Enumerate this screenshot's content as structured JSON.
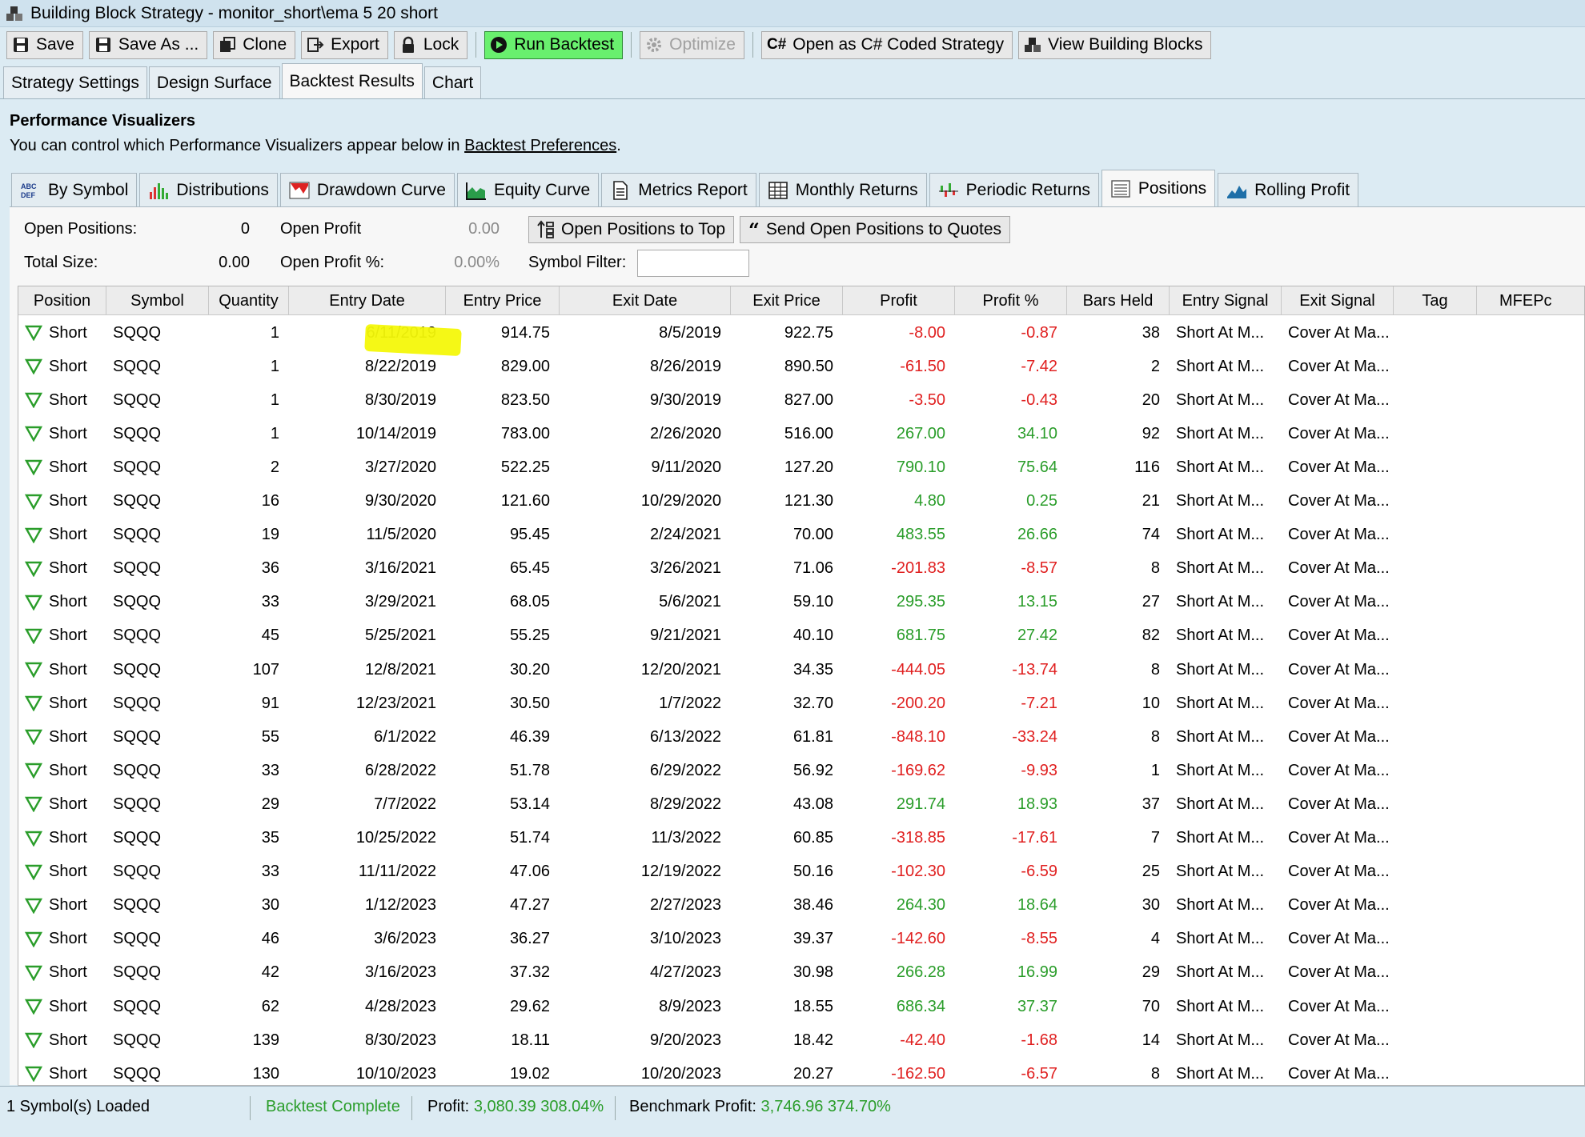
{
  "window": {
    "title": "Building Block Strategy - monitor_short\\ema 5 20 short"
  },
  "toolbar": {
    "save": "Save",
    "save_as": "Save As ...",
    "clone": "Clone",
    "export": "Export",
    "lock": "Lock",
    "run_backtest": "Run Backtest",
    "optimize": "Optimize",
    "open_csharp": "Open as C# Coded Strategy",
    "view_blocks": "View Building Blocks"
  },
  "main_tabs": [
    "Strategy Settings",
    "Design Surface",
    "Backtest Results",
    "Chart"
  ],
  "performance": {
    "title": "Performance Visualizers",
    "subtitle": "You can control which Performance Visualizers appear below in",
    "link": "Backtest Preferences",
    "period": "."
  },
  "vis_tabs": [
    "By Symbol",
    "Distributions",
    "Drawdown Curve",
    "Equity Curve",
    "Metrics Report",
    "Monthly Returns",
    "Periodic Returns",
    "Positions",
    "Rolling Profit"
  ],
  "positions_panel": {
    "open_positions_label": "Open Positions:",
    "open_positions_value": "0",
    "open_profit_label": "Open Profit",
    "open_profit_value": "0.00",
    "total_size_label": "Total Size:",
    "total_size_value": "0.00",
    "open_profit_pct_label": "Open Profit %:",
    "open_profit_pct_value": "0.00%",
    "btn_open_top": "Open Positions to Top",
    "btn_send_quotes": "Send Open Positions to Quotes",
    "symbol_filter_label": "Symbol Filter:",
    "symbol_filter_value": ""
  },
  "table": {
    "columns": [
      "Position",
      "Symbol",
      "Quantity",
      "Entry Date",
      "Entry Price",
      "Exit Date",
      "Exit Price",
      "Profit",
      "Profit %",
      "Bars Held",
      "Entry Signal",
      "Exit Signal",
      "Tag",
      "MFEPc"
    ],
    "rows": [
      [
        "Short",
        "SQQQ",
        "1",
        "6/11/2019",
        "914.75",
        "8/5/2019",
        "922.75",
        "-8.00",
        "-0.87",
        "38",
        "Short At M...",
        "Cover At Ma...",
        ""
      ],
      [
        "Short",
        "SQQQ",
        "1",
        "8/22/2019",
        "829.00",
        "8/26/2019",
        "890.50",
        "-61.50",
        "-7.42",
        "2",
        "Short At M...",
        "Cover At Ma...",
        ""
      ],
      [
        "Short",
        "SQQQ",
        "1",
        "8/30/2019",
        "823.50",
        "9/30/2019",
        "827.00",
        "-3.50",
        "-0.43",
        "20",
        "Short At M...",
        "Cover At Ma...",
        ""
      ],
      [
        "Short",
        "SQQQ",
        "1",
        "10/14/2019",
        "783.00",
        "2/26/2020",
        "516.00",
        "267.00",
        "34.10",
        "92",
        "Short At M...",
        "Cover At Ma...",
        ""
      ],
      [
        "Short",
        "SQQQ",
        "2",
        "3/27/2020",
        "522.25",
        "9/11/2020",
        "127.20",
        "790.10",
        "75.64",
        "116",
        "Short At M...",
        "Cover At Ma...",
        ""
      ],
      [
        "Short",
        "SQQQ",
        "16",
        "9/30/2020",
        "121.60",
        "10/29/2020",
        "121.30",
        "4.80",
        "0.25",
        "21",
        "Short At M...",
        "Cover At Ma...",
        ""
      ],
      [
        "Short",
        "SQQQ",
        "19",
        "11/5/2020",
        "95.45",
        "2/24/2021",
        "70.00",
        "483.55",
        "26.66",
        "74",
        "Short At M...",
        "Cover At Ma...",
        ""
      ],
      [
        "Short",
        "SQQQ",
        "36",
        "3/16/2021",
        "65.45",
        "3/26/2021",
        "71.06",
        "-201.83",
        "-8.57",
        "8",
        "Short At M...",
        "Cover At Ma...",
        ""
      ],
      [
        "Short",
        "SQQQ",
        "33",
        "3/29/2021",
        "68.05",
        "5/6/2021",
        "59.10",
        "295.35",
        "13.15",
        "27",
        "Short At M...",
        "Cover At Ma...",
        ""
      ],
      [
        "Short",
        "SQQQ",
        "45",
        "5/25/2021",
        "55.25",
        "9/21/2021",
        "40.10",
        "681.75",
        "27.42",
        "82",
        "Short At M...",
        "Cover At Ma...",
        ""
      ],
      [
        "Short",
        "SQQQ",
        "107",
        "12/8/2021",
        "30.20",
        "12/20/2021",
        "34.35",
        "-444.05",
        "-13.74",
        "8",
        "Short At M...",
        "Cover At Ma...",
        ""
      ],
      [
        "Short",
        "SQQQ",
        "91",
        "12/23/2021",
        "30.50",
        "1/7/2022",
        "32.70",
        "-200.20",
        "-7.21",
        "10",
        "Short At M...",
        "Cover At Ma...",
        ""
      ],
      [
        "Short",
        "SQQQ",
        "55",
        "6/1/2022",
        "46.39",
        "6/13/2022",
        "61.81",
        "-848.10",
        "-33.24",
        "8",
        "Short At M...",
        "Cover At Ma...",
        ""
      ],
      [
        "Short",
        "SQQQ",
        "33",
        "6/28/2022",
        "51.78",
        "6/29/2022",
        "56.92",
        "-169.62",
        "-9.93",
        "1",
        "Short At M...",
        "Cover At Ma...",
        ""
      ],
      [
        "Short",
        "SQQQ",
        "29",
        "7/7/2022",
        "53.14",
        "8/29/2022",
        "43.08",
        "291.74",
        "18.93",
        "37",
        "Short At M...",
        "Cover At Ma...",
        ""
      ],
      [
        "Short",
        "SQQQ",
        "35",
        "10/25/2022",
        "51.74",
        "11/3/2022",
        "60.85",
        "-318.85",
        "-17.61",
        "7",
        "Short At M...",
        "Cover At Ma...",
        ""
      ],
      [
        "Short",
        "SQQQ",
        "33",
        "11/11/2022",
        "47.06",
        "12/19/2022",
        "50.16",
        "-102.30",
        "-6.59",
        "25",
        "Short At M...",
        "Cover At Ma...",
        ""
      ],
      [
        "Short",
        "SQQQ",
        "30",
        "1/12/2023",
        "47.27",
        "2/27/2023",
        "38.46",
        "264.30",
        "18.64",
        "30",
        "Short At M...",
        "Cover At Ma...",
        ""
      ],
      [
        "Short",
        "SQQQ",
        "46",
        "3/6/2023",
        "36.27",
        "3/10/2023",
        "39.37",
        "-142.60",
        "-8.55",
        "4",
        "Short At M...",
        "Cover At Ma...",
        ""
      ],
      [
        "Short",
        "SQQQ",
        "42",
        "3/16/2023",
        "37.32",
        "4/27/2023",
        "30.98",
        "266.28",
        "16.99",
        "29",
        "Short At M...",
        "Cover At Ma...",
        ""
      ],
      [
        "Short",
        "SQQQ",
        "62",
        "4/28/2023",
        "29.62",
        "8/9/2023",
        "18.55",
        "686.34",
        "37.37",
        "70",
        "Short At M...",
        "Cover At Ma...",
        ""
      ],
      [
        "Short",
        "SQQQ",
        "139",
        "8/30/2023",
        "18.11",
        "9/20/2023",
        "18.42",
        "-42.40",
        "-1.68",
        "14",
        "Short At M...",
        "Cover At Ma...",
        ""
      ],
      [
        "Short",
        "SQQQ",
        "130",
        "10/10/2023",
        "19.02",
        "10/20/2023",
        "20.27",
        "-162.50",
        "-6.57",
        "8",
        "Short At M...",
        "Cover At Ma...",
        ""
      ]
    ]
  },
  "status": {
    "symbols": "1 Symbol(s) Loaded",
    "backtest": "Backtest Complete",
    "profit_label": "Profit:",
    "profit_value": "3,080.39 308.04%",
    "benchmark_label": "Benchmark Profit:",
    "benchmark_value": "3,746.96 374.70%"
  },
  "colors": {
    "positive": "#2a9d2a",
    "negative": "#e02020",
    "run_button": "#69f06e",
    "highlight": "#f4f80a"
  }
}
